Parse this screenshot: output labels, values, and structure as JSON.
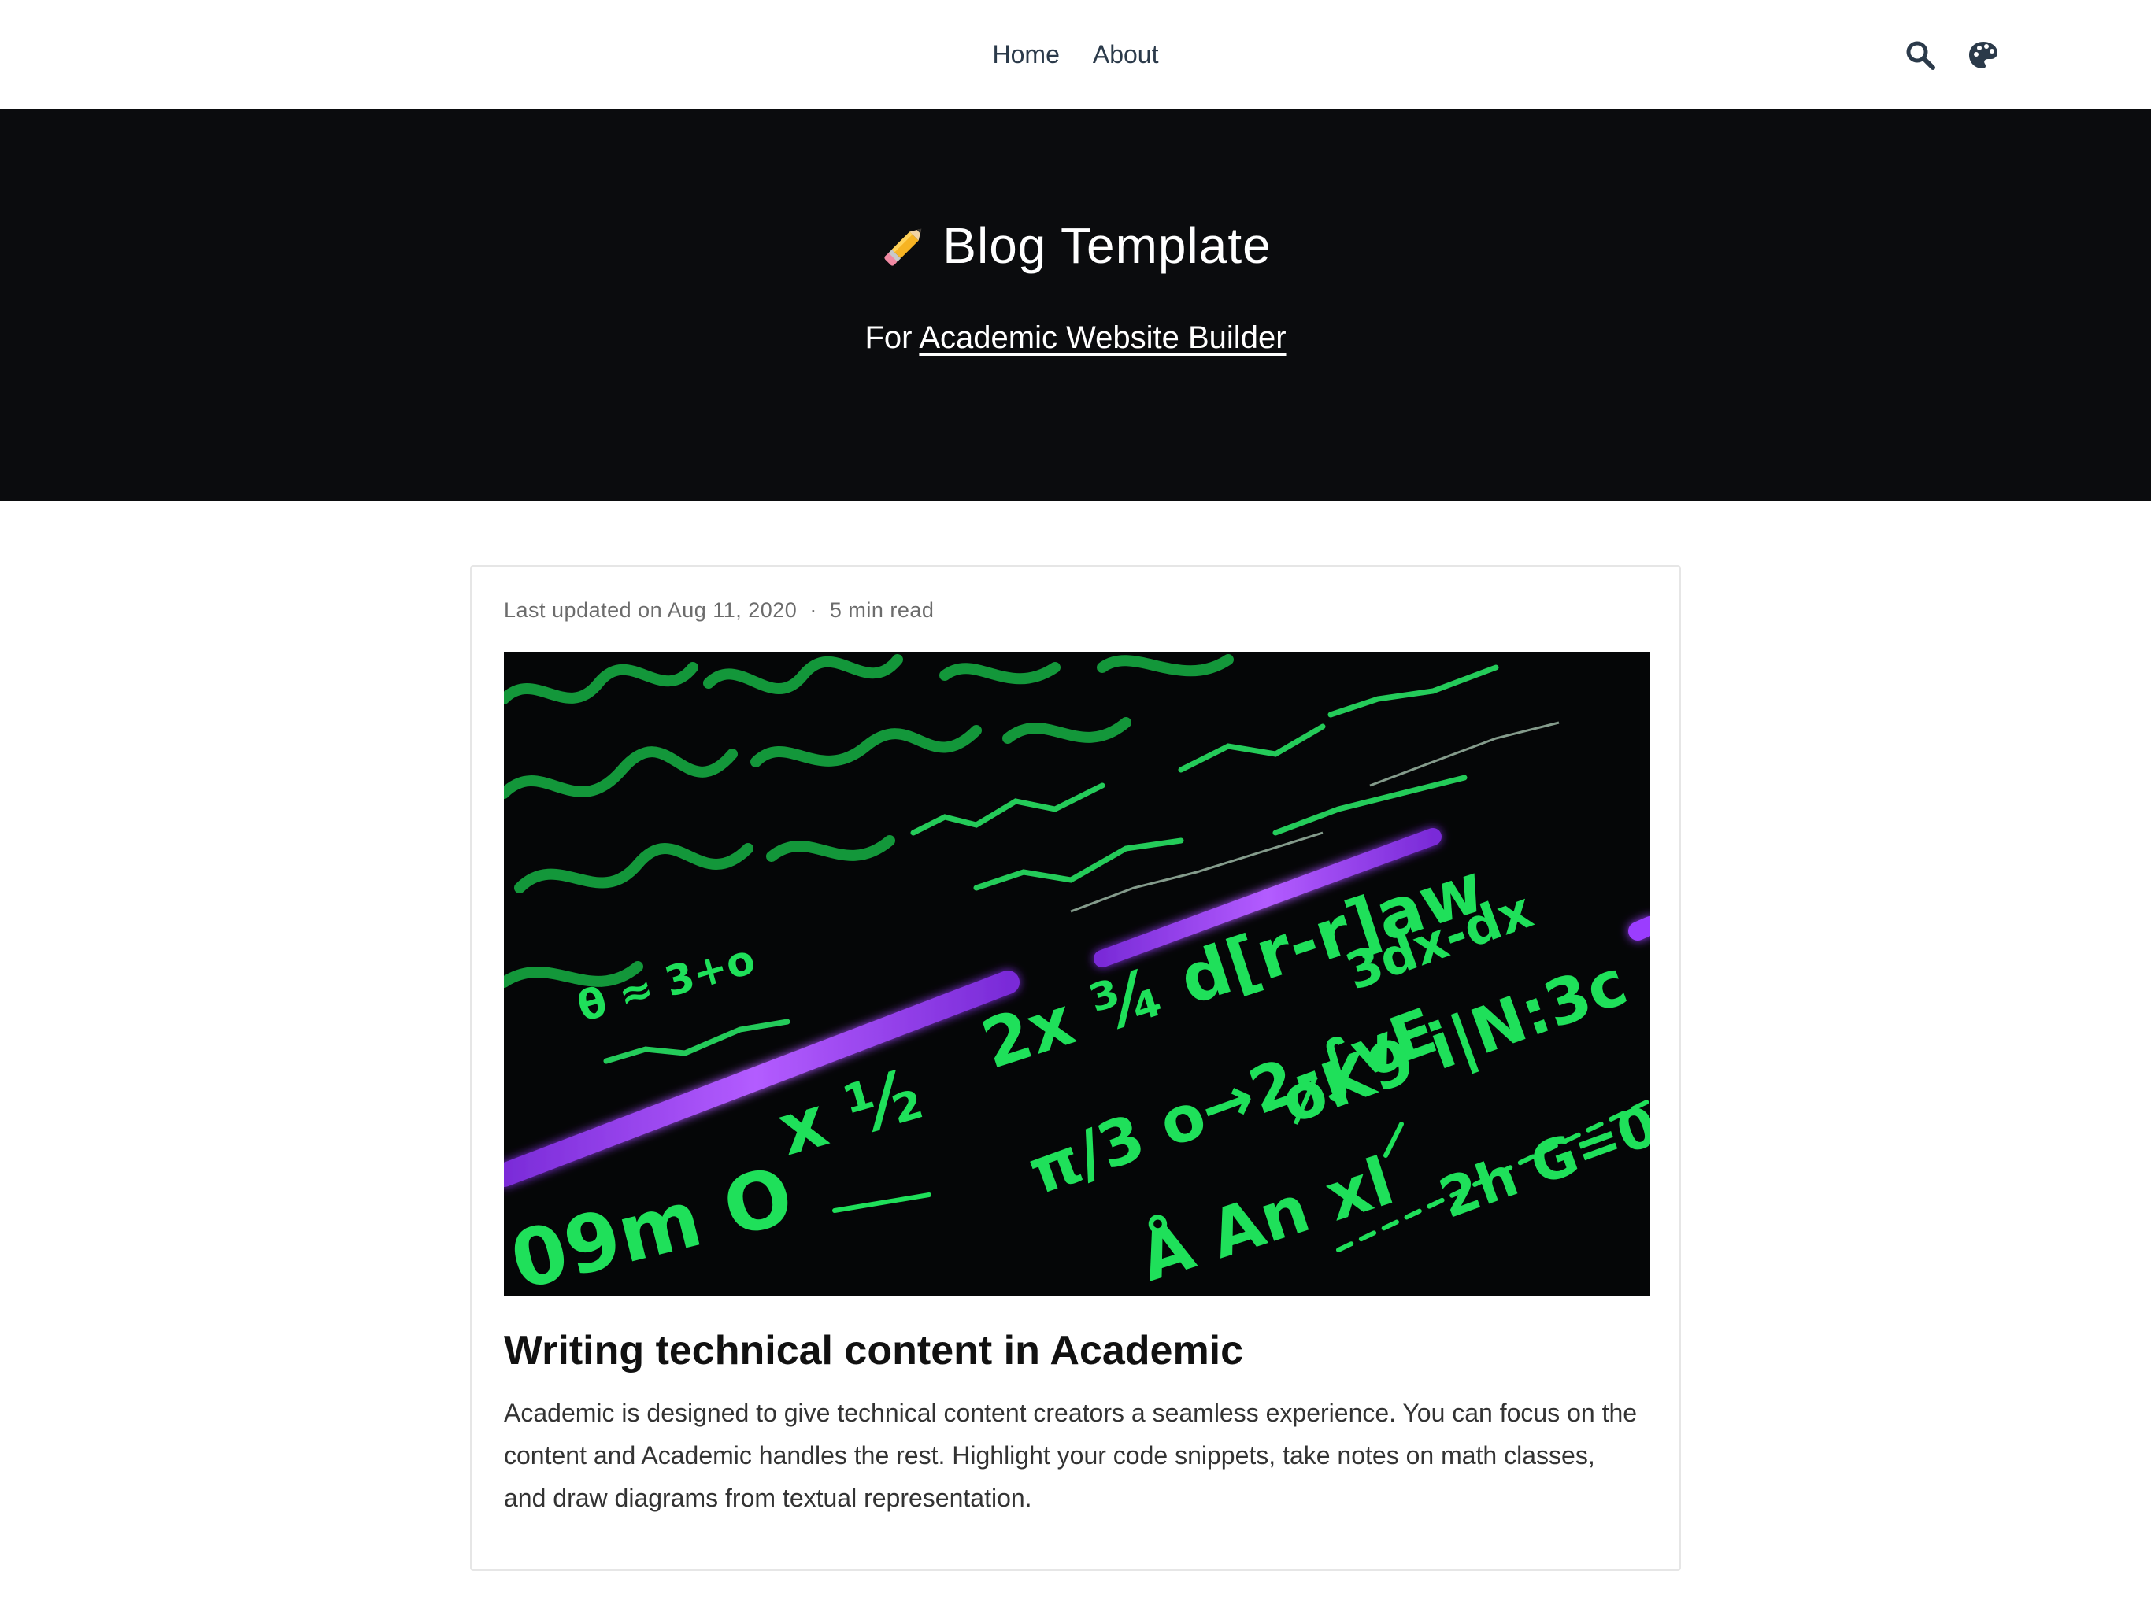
{
  "nav": {
    "links": [
      "Home",
      "About"
    ],
    "icons": [
      "search-icon",
      "palette-icon"
    ],
    "text_color": "#2b3a4a"
  },
  "hero": {
    "icon": "pencil-icon",
    "title": "Blog Template",
    "subtitle_prefix": "For ",
    "subtitle_link": "Academic Website Builder",
    "background": "#0b0c0e"
  },
  "post": {
    "meta_updated": "Last updated on Aug 11, 2020",
    "meta_separator": "·",
    "meta_read_time": "5 min read",
    "image": "green-math-equations-chalkboard",
    "title": "Writing technical content in Academic",
    "summary": "Academic is designed to give technical content creators a seamless experience. You can focus on the content and Academic handles the rest. Highlight your code snippets, take notes on math classes, and draw diagrams from textual representation."
  },
  "colors": {
    "equation_green": "#1fe05a",
    "neon_purple": "#9b3cff"
  }
}
